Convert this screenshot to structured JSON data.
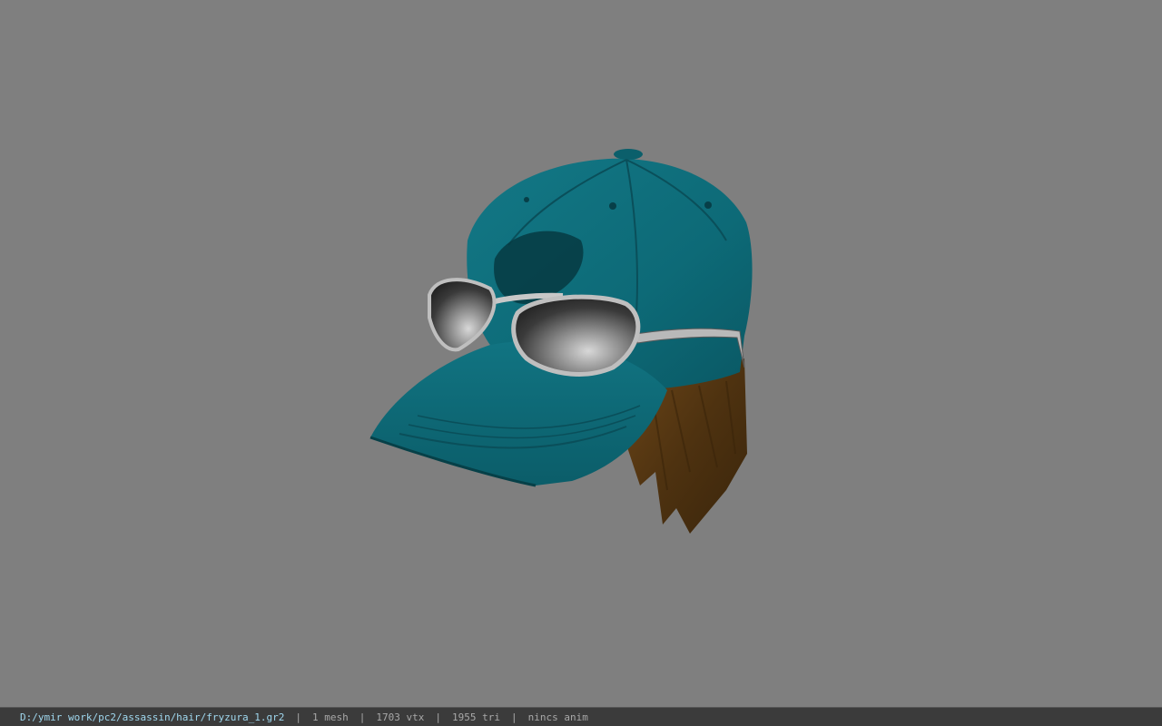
{
  "status_bar": {
    "file_path": "D:/ymir work/pc2/assassin/hair/fryzura_1.gr2",
    "separator": "|",
    "mesh_count": "1 mesh",
    "vertex_count": "1703 vtx",
    "triangle_count": "1955 tri",
    "animation_status": "nincs anim"
  },
  "viewport": {
    "background_color": "#7f7f7f",
    "model_parts": [
      "cap-icon",
      "sunglasses-icon",
      "hair-icon"
    ],
    "colors": {
      "cap": "#0f6b78",
      "cap_dark": "#084650",
      "sunglasses_frame": "#c8c8c8",
      "lens": "#2e2e2e",
      "hair": "#5a3a14"
    }
  }
}
